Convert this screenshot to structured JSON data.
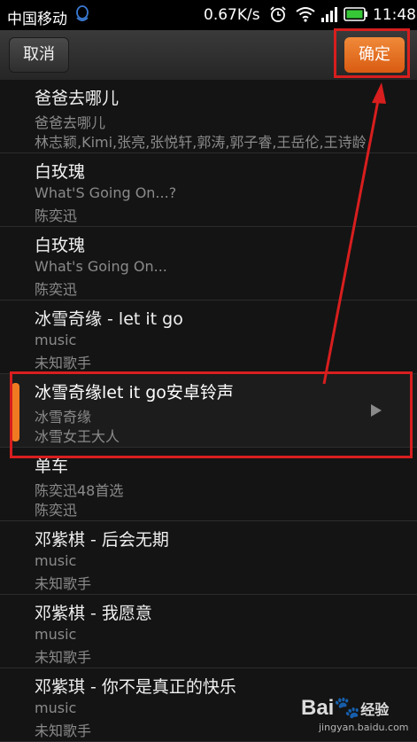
{
  "status_bar": {
    "carrier": "中国移动",
    "net_speed": "0.67K/s",
    "time": "11:48",
    "icons": [
      "qq-icon",
      "alarm-icon",
      "wifi-icon",
      "signal-icon",
      "battery-icon"
    ]
  },
  "header": {
    "cancel_label": "取消",
    "confirm_label": "确定"
  },
  "songs": [
    {
      "title": "爸爸去哪儿",
      "album": "爸爸去哪儿",
      "artist": "林志颖,Kimi,张亮,张悦轩,郭涛,郭子睿,王岳伦,王诗龄"
    },
    {
      "title": "白玫瑰",
      "album": "What'S Going On...?",
      "artist": "陈奕迅"
    },
    {
      "title": "白玫瑰",
      "album": "What's Going On...",
      "artist": "陈奕迅"
    },
    {
      "title": "冰雪奇缘 - let it go",
      "album": "music",
      "artist": "未知歌手"
    },
    {
      "title": "冰雪奇缘let it go安卓铃声",
      "album": "冰雪奇缘",
      "artist": "冰雪女王大人",
      "selected": true
    },
    {
      "title": "单车",
      "album": "陈奕迅48首选",
      "artist": "陈奕迅"
    },
    {
      "title": "邓紫棋 - 后会无期",
      "album": "music",
      "artist": "未知歌手"
    },
    {
      "title": "邓紫棋 - 我愿意",
      "album": "music",
      "artist": "未知歌手"
    },
    {
      "title": "邓紫琪 - 你不是真正的快乐",
      "album": "music",
      "artist": "未知歌手"
    }
  ],
  "watermark": {
    "logo": "Bai",
    "logo_suffix": "经验",
    "site": "jingyan.baidu.com"
  },
  "colors": {
    "accent": "#f07a22",
    "annotation_red": "#d81e1e",
    "background": "#141414"
  }
}
